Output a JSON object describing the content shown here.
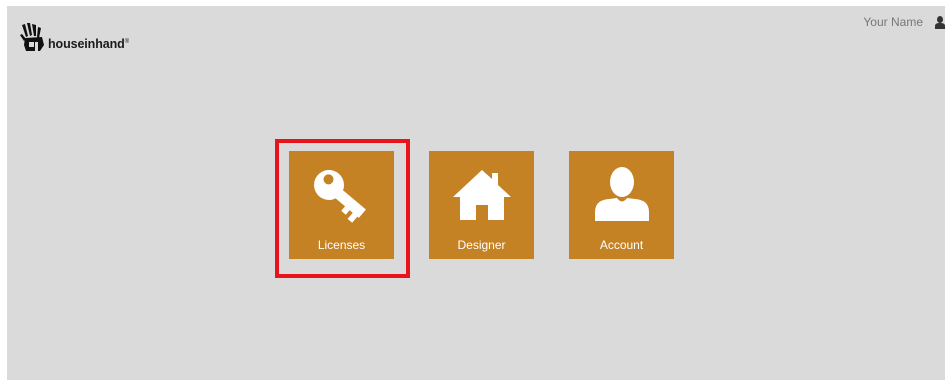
{
  "header": {
    "brand": "houseinhand",
    "brand_mark": "®",
    "user_name": "Your Name",
    "user_icon": "user-icon"
  },
  "tiles": [
    {
      "label": "Licenses",
      "icon": "key-icon"
    },
    {
      "label": "Designer",
      "icon": "house-icon"
    },
    {
      "label": "Account",
      "icon": "user-silhouette-icon"
    }
  ],
  "colors": {
    "background": "#dadada",
    "tile": "#c48225",
    "highlight": "#e8141b"
  }
}
